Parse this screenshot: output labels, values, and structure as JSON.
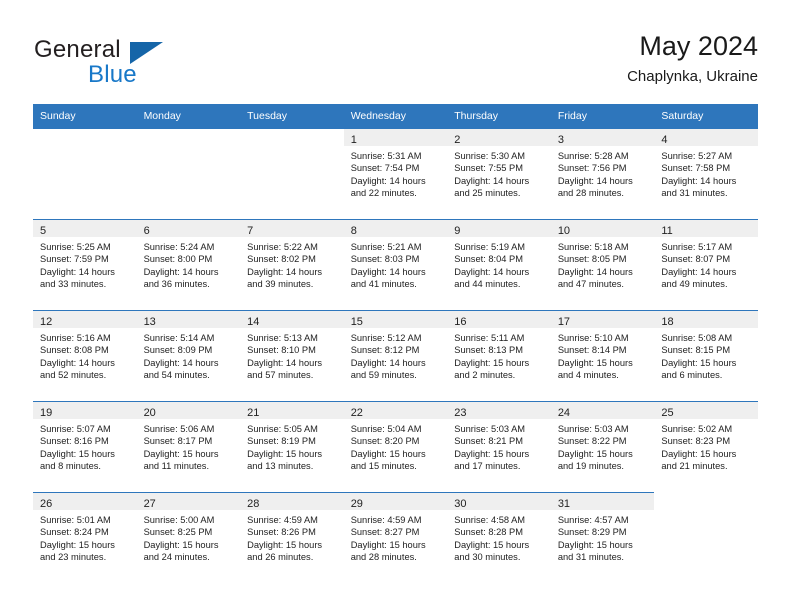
{
  "brand": {
    "name_top": "General",
    "name_bottom": "Blue",
    "triangle_color": "#1565a8",
    "blue_text_color": "#1878c8"
  },
  "header": {
    "title": "May 2024",
    "subtitle": "Chaplynka, Ukraine"
  },
  "theme": {
    "header_blue": "#2e76bc",
    "daynum_strip": "#efefef",
    "text": "#222222"
  },
  "weekdays": [
    "Sunday",
    "Monday",
    "Tuesday",
    "Wednesday",
    "Thursday",
    "Friday",
    "Saturday"
  ],
  "weeks": [
    [
      {
        "day": "",
        "empty": true
      },
      {
        "day": "",
        "empty": true
      },
      {
        "day": "",
        "empty": true
      },
      {
        "day": "1",
        "sunrise": "Sunrise: 5:31 AM",
        "sunset": "Sunset: 7:54 PM",
        "daylight1": "Daylight: 14 hours",
        "daylight2": "and 22 minutes."
      },
      {
        "day": "2",
        "sunrise": "Sunrise: 5:30 AM",
        "sunset": "Sunset: 7:55 PM",
        "daylight1": "Daylight: 14 hours",
        "daylight2": "and 25 minutes."
      },
      {
        "day": "3",
        "sunrise": "Sunrise: 5:28 AM",
        "sunset": "Sunset: 7:56 PM",
        "daylight1": "Daylight: 14 hours",
        "daylight2": "and 28 minutes."
      },
      {
        "day": "4",
        "sunrise": "Sunrise: 5:27 AM",
        "sunset": "Sunset: 7:58 PM",
        "daylight1": "Daylight: 14 hours",
        "daylight2": "and 31 minutes."
      }
    ],
    [
      {
        "day": "5",
        "sunrise": "Sunrise: 5:25 AM",
        "sunset": "Sunset: 7:59 PM",
        "daylight1": "Daylight: 14 hours",
        "daylight2": "and 33 minutes."
      },
      {
        "day": "6",
        "sunrise": "Sunrise: 5:24 AM",
        "sunset": "Sunset: 8:00 PM",
        "daylight1": "Daylight: 14 hours",
        "daylight2": "and 36 minutes."
      },
      {
        "day": "7",
        "sunrise": "Sunrise: 5:22 AM",
        "sunset": "Sunset: 8:02 PM",
        "daylight1": "Daylight: 14 hours",
        "daylight2": "and 39 minutes."
      },
      {
        "day": "8",
        "sunrise": "Sunrise: 5:21 AM",
        "sunset": "Sunset: 8:03 PM",
        "daylight1": "Daylight: 14 hours",
        "daylight2": "and 41 minutes."
      },
      {
        "day": "9",
        "sunrise": "Sunrise: 5:19 AM",
        "sunset": "Sunset: 8:04 PM",
        "daylight1": "Daylight: 14 hours",
        "daylight2": "and 44 minutes."
      },
      {
        "day": "10",
        "sunrise": "Sunrise: 5:18 AM",
        "sunset": "Sunset: 8:05 PM",
        "daylight1": "Daylight: 14 hours",
        "daylight2": "and 47 minutes."
      },
      {
        "day": "11",
        "sunrise": "Sunrise: 5:17 AM",
        "sunset": "Sunset: 8:07 PM",
        "daylight1": "Daylight: 14 hours",
        "daylight2": "and 49 minutes."
      }
    ],
    [
      {
        "day": "12",
        "sunrise": "Sunrise: 5:16 AM",
        "sunset": "Sunset: 8:08 PM",
        "daylight1": "Daylight: 14 hours",
        "daylight2": "and 52 minutes."
      },
      {
        "day": "13",
        "sunrise": "Sunrise: 5:14 AM",
        "sunset": "Sunset: 8:09 PM",
        "daylight1": "Daylight: 14 hours",
        "daylight2": "and 54 minutes."
      },
      {
        "day": "14",
        "sunrise": "Sunrise: 5:13 AM",
        "sunset": "Sunset: 8:10 PM",
        "daylight1": "Daylight: 14 hours",
        "daylight2": "and 57 minutes."
      },
      {
        "day": "15",
        "sunrise": "Sunrise: 5:12 AM",
        "sunset": "Sunset: 8:12 PM",
        "daylight1": "Daylight: 14 hours",
        "daylight2": "and 59 minutes."
      },
      {
        "day": "16",
        "sunrise": "Sunrise: 5:11 AM",
        "sunset": "Sunset: 8:13 PM",
        "daylight1": "Daylight: 15 hours",
        "daylight2": "and 2 minutes."
      },
      {
        "day": "17",
        "sunrise": "Sunrise: 5:10 AM",
        "sunset": "Sunset: 8:14 PM",
        "daylight1": "Daylight: 15 hours",
        "daylight2": "and 4 minutes."
      },
      {
        "day": "18",
        "sunrise": "Sunrise: 5:08 AM",
        "sunset": "Sunset: 8:15 PM",
        "daylight1": "Daylight: 15 hours",
        "daylight2": "and 6 minutes."
      }
    ],
    [
      {
        "day": "19",
        "sunrise": "Sunrise: 5:07 AM",
        "sunset": "Sunset: 8:16 PM",
        "daylight1": "Daylight: 15 hours",
        "daylight2": "and 8 minutes."
      },
      {
        "day": "20",
        "sunrise": "Sunrise: 5:06 AM",
        "sunset": "Sunset: 8:17 PM",
        "daylight1": "Daylight: 15 hours",
        "daylight2": "and 11 minutes."
      },
      {
        "day": "21",
        "sunrise": "Sunrise: 5:05 AM",
        "sunset": "Sunset: 8:19 PM",
        "daylight1": "Daylight: 15 hours",
        "daylight2": "and 13 minutes."
      },
      {
        "day": "22",
        "sunrise": "Sunrise: 5:04 AM",
        "sunset": "Sunset: 8:20 PM",
        "daylight1": "Daylight: 15 hours",
        "daylight2": "and 15 minutes."
      },
      {
        "day": "23",
        "sunrise": "Sunrise: 5:03 AM",
        "sunset": "Sunset: 8:21 PM",
        "daylight1": "Daylight: 15 hours",
        "daylight2": "and 17 minutes."
      },
      {
        "day": "24",
        "sunrise": "Sunrise: 5:03 AM",
        "sunset": "Sunset: 8:22 PM",
        "daylight1": "Daylight: 15 hours",
        "daylight2": "and 19 minutes."
      },
      {
        "day": "25",
        "sunrise": "Sunrise: 5:02 AM",
        "sunset": "Sunset: 8:23 PM",
        "daylight1": "Daylight: 15 hours",
        "daylight2": "and 21 minutes."
      }
    ],
    [
      {
        "day": "26",
        "sunrise": "Sunrise: 5:01 AM",
        "sunset": "Sunset: 8:24 PM",
        "daylight1": "Daylight: 15 hours",
        "daylight2": "and 23 minutes."
      },
      {
        "day": "27",
        "sunrise": "Sunrise: 5:00 AM",
        "sunset": "Sunset: 8:25 PM",
        "daylight1": "Daylight: 15 hours",
        "daylight2": "and 24 minutes."
      },
      {
        "day": "28",
        "sunrise": "Sunrise: 4:59 AM",
        "sunset": "Sunset: 8:26 PM",
        "daylight1": "Daylight: 15 hours",
        "daylight2": "and 26 minutes."
      },
      {
        "day": "29",
        "sunrise": "Sunrise: 4:59 AM",
        "sunset": "Sunset: 8:27 PM",
        "daylight1": "Daylight: 15 hours",
        "daylight2": "and 28 minutes."
      },
      {
        "day": "30",
        "sunrise": "Sunrise: 4:58 AM",
        "sunset": "Sunset: 8:28 PM",
        "daylight1": "Daylight: 15 hours",
        "daylight2": "and 30 minutes."
      },
      {
        "day": "31",
        "sunrise": "Sunrise: 4:57 AM",
        "sunset": "Sunset: 8:29 PM",
        "daylight1": "Daylight: 15 hours",
        "daylight2": "and 31 minutes."
      },
      {
        "day": "",
        "blank": true
      }
    ]
  ]
}
